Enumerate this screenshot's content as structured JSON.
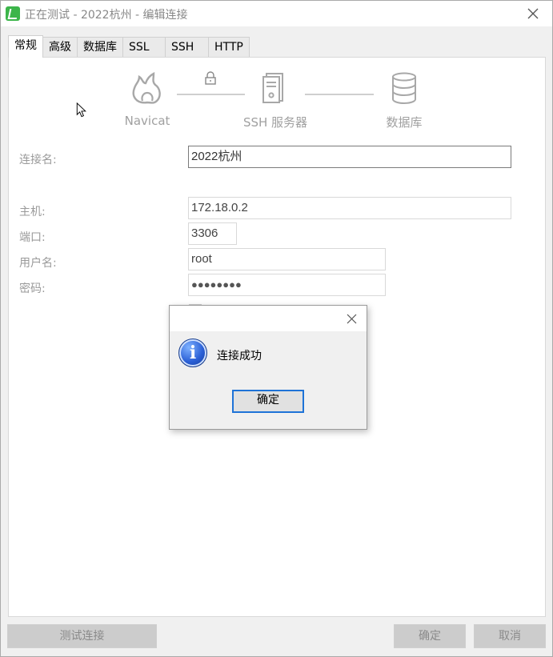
{
  "window": {
    "title": "正在测试 - 2022杭州 - 编辑连接"
  },
  "tabs": [
    {
      "label": "常规",
      "active": true
    },
    {
      "label": "高级"
    },
    {
      "label": "数据库"
    },
    {
      "label": "SSL"
    },
    {
      "label": "SSH"
    },
    {
      "label": "HTTP"
    }
  ],
  "diagram": {
    "nodes": [
      {
        "label": "Navicat",
        "icon": "navicat-logo-icon"
      },
      {
        "label": "SSH 服务器",
        "icon": "server-icon"
      },
      {
        "label": "数据库",
        "icon": "database-icon"
      }
    ],
    "link_icon": "lock-icon"
  },
  "form": {
    "connection_name_label": "连接名:",
    "connection_name_value": "2022杭州",
    "host_label": "主机:",
    "host_value": "172.18.0.2",
    "port_label": "端口:",
    "port_value": "3306",
    "username_label": "用户名:",
    "username_value": "root",
    "password_label": "密码:",
    "password_value": "●●●●●●●●"
  },
  "dialog": {
    "message": "连接成功",
    "ok_label": "确定",
    "icon": "info-icon"
  },
  "footer": {
    "test_connection_label": "测试连接",
    "ok_label": "确定",
    "cancel_label": "取消"
  }
}
